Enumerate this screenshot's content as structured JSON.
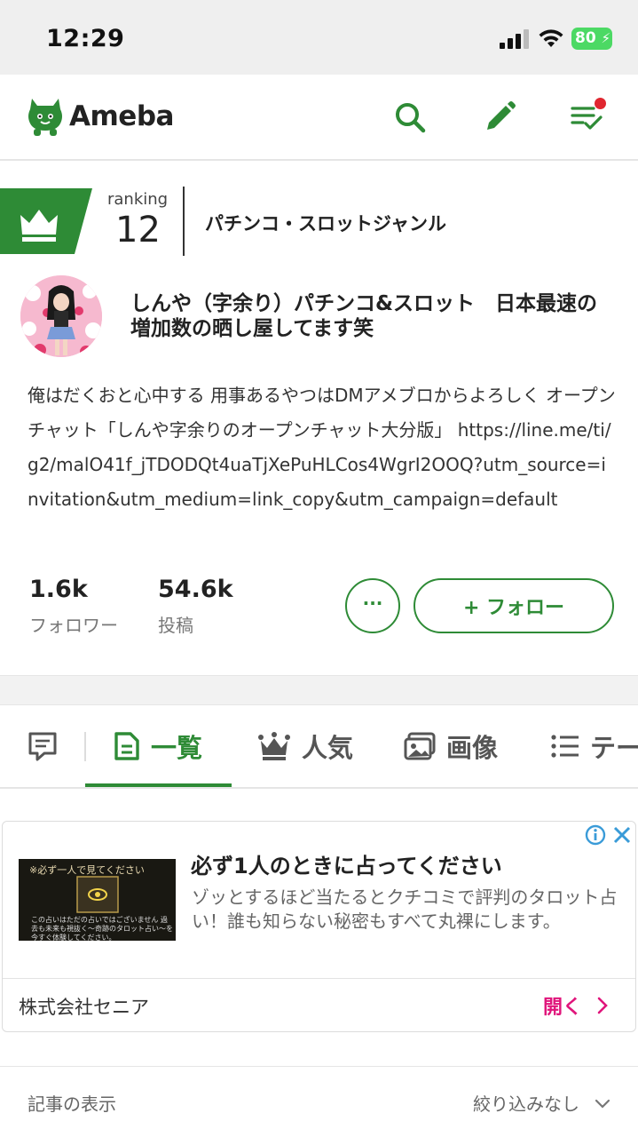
{
  "status_bar": {
    "time": "12:29",
    "battery": "80"
  },
  "header": {
    "logo_text": "Ameba"
  },
  "ranking": {
    "label": "ranking",
    "number": "12",
    "genre": "パチンコ・スロットジャンル"
  },
  "profile": {
    "blog_title": "しんや（字余り）パチンコ&スロット　日本最速の増加数の晒し屋してます笑",
    "description": "俺はだくおと心中する 用事あるやつはDMアメブロからよろしく オープンチャット「しんや字余りのオープンチャット大分版」 https://line.me/ti/g2/malO41f_jTDODQt4uaTjXePuHLCos4WgrI2OOQ?utm_source=invitation&utm_medium=link_copy&utm_campaign=default"
  },
  "stats": {
    "followers_value": "1.6k",
    "followers_label": "フォロワー",
    "posts_value": "54.6k",
    "posts_label": "投稿"
  },
  "actions": {
    "more_label": "···",
    "follow_label": "+ フォロー"
  },
  "tabs": [
    {
      "label": "一覧",
      "icon": "document-icon",
      "active": true
    },
    {
      "label": "人気",
      "icon": "crown-icon"
    },
    {
      "label": "画像",
      "icon": "image-icon"
    },
    {
      "label": "テー",
      "icon": "list-icon"
    }
  ],
  "ad": {
    "image_caption_top": "※必ず一人で見てください",
    "image_caption_bottom": "この占いはただの占いではございません 過去も未来も視抜く〜奇跡のタロット占い〜を今すぐ体験してください。",
    "title": "必ず1人のときに占ってください",
    "body": "ゾッとするほど当たるとクチコミで評判のタロット占い！誰も知らない秘密もすべて丸裸にします。",
    "company": "株式会社セニア",
    "open_label": "開く"
  },
  "filter": {
    "label": "記事の表示",
    "value": "絞り込みなし"
  },
  "colors": {
    "brand_green": "#2e8b36",
    "ad_accent": "#e0157b",
    "notification": "#e0262f"
  }
}
